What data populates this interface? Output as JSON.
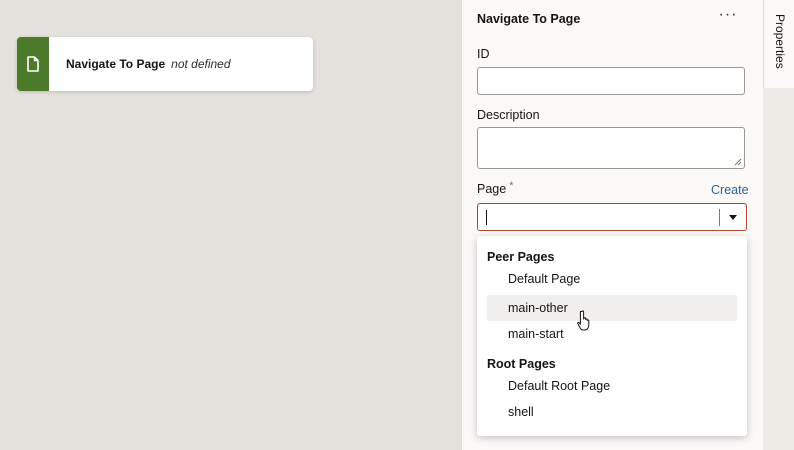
{
  "canvas": {
    "node": {
      "title": "Navigate To Page",
      "status": "not defined",
      "icon": "page-icon",
      "color": "#4a7a2a"
    }
  },
  "panel": {
    "title": "Navigate To Page",
    "more_label": "···",
    "id": {
      "label": "ID",
      "value": ""
    },
    "description": {
      "label": "Description",
      "value": ""
    },
    "page": {
      "label": "Page",
      "required_marker": "*",
      "create_label": "Create",
      "value": ""
    },
    "dropdown": {
      "groups": [
        {
          "header": "Peer Pages",
          "options": [
            "Default Page",
            "main-other",
            "main-start"
          ]
        },
        {
          "header": "Root Pages",
          "options": [
            "Default Root Page",
            "shell"
          ]
        }
      ],
      "hovered": "main-other"
    }
  },
  "side_tabs": {
    "properties": "Properties"
  },
  "colors": {
    "accent_link": "#2a6495",
    "error_border": "#b3462e"
  }
}
